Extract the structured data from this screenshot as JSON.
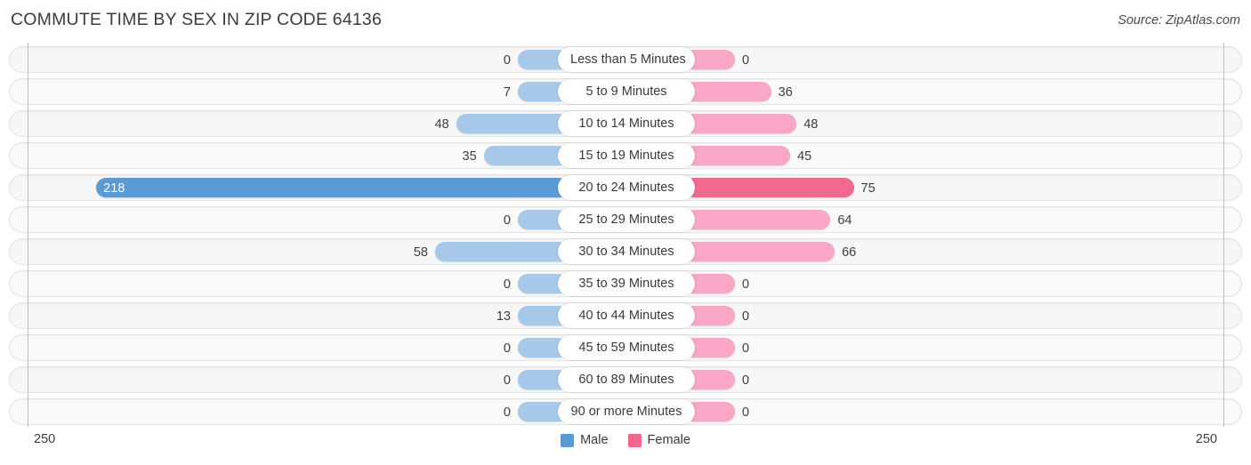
{
  "header": {
    "title": "COMMUTE TIME BY SEX IN ZIP CODE 64136",
    "source": "Source: ZipAtlas.com"
  },
  "legend": {
    "male_label": "Male",
    "female_label": "Female",
    "male_color": "#5b9bd5",
    "female_color": "#f2688f"
  },
  "axis": {
    "left_end_label": "250",
    "right_end_label": "250",
    "max": 250
  },
  "colors": {
    "male_light": "#a6c9e9",
    "female_light": "#f9a7c4",
    "male_peak": "#5b9bd5",
    "female_peak": "#f2688f",
    "row_background": "#f7f7f7",
    "row_border": "#e3e3e3"
  },
  "chart_data": {
    "type": "bar",
    "title": "COMMUTE TIME BY SEX IN ZIP CODE 64136",
    "subtitle": "Source: ZipAtlas.com",
    "xlabel": "",
    "ylabel": "",
    "orientation": "horizontal-diverging",
    "grid": false,
    "legend_position": "bottom-center",
    "xlim": [
      250,
      250
    ],
    "categories": [
      "Less than 5 Minutes",
      "5 to 9 Minutes",
      "10 to 14 Minutes",
      "15 to 19 Minutes",
      "20 to 24 Minutes",
      "25 to 29 Minutes",
      "30 to 34 Minutes",
      "35 to 39 Minutes",
      "40 to 44 Minutes",
      "45 to 59 Minutes",
      "60 to 89 Minutes",
      "90 or more Minutes"
    ],
    "series": [
      {
        "name": "Male",
        "direction": "left",
        "values": [
          0,
          7,
          48,
          35,
          218,
          0,
          58,
          0,
          13,
          0,
          0,
          0
        ]
      },
      {
        "name": "Female",
        "direction": "right",
        "values": [
          0,
          36,
          48,
          45,
          75,
          64,
          66,
          0,
          0,
          0,
          0,
          0
        ]
      }
    ],
    "rows": [
      {
        "category": "Less than 5 Minutes",
        "male": 0,
        "female": 0,
        "male_text": "0",
        "female_text": "0"
      },
      {
        "category": "5 to 9 Minutes",
        "male": 7,
        "female": 36,
        "male_text": "7",
        "female_text": "36"
      },
      {
        "category": "10 to 14 Minutes",
        "male": 48,
        "female": 48,
        "male_text": "48",
        "female_text": "48"
      },
      {
        "category": "15 to 19 Minutes",
        "male": 35,
        "female": 45,
        "male_text": "35",
        "female_text": "45"
      },
      {
        "category": "20 to 24 Minutes",
        "male": 218,
        "female": 75,
        "male_text": "218",
        "female_text": "75"
      },
      {
        "category": "25 to 29 Minutes",
        "male": 0,
        "female": 64,
        "male_text": "0",
        "female_text": "64"
      },
      {
        "category": "30 to 34 Minutes",
        "male": 58,
        "female": 66,
        "male_text": "58",
        "female_text": "66"
      },
      {
        "category": "35 to 39 Minutes",
        "male": 0,
        "female": 0,
        "male_text": "0",
        "female_text": "0"
      },
      {
        "category": "40 to 44 Minutes",
        "male": 13,
        "female": 0,
        "male_text": "13",
        "female_text": "0"
      },
      {
        "category": "45 to 59 Minutes",
        "male": 0,
        "female": 0,
        "male_text": "0",
        "female_text": "0"
      },
      {
        "category": "60 to 89 Minutes",
        "male": 0,
        "female": 0,
        "male_text": "0",
        "female_text": "0"
      },
      {
        "category": "90 or more Minutes",
        "male": 0,
        "female": 0,
        "male_text": "0",
        "female_text": "0"
      }
    ]
  }
}
